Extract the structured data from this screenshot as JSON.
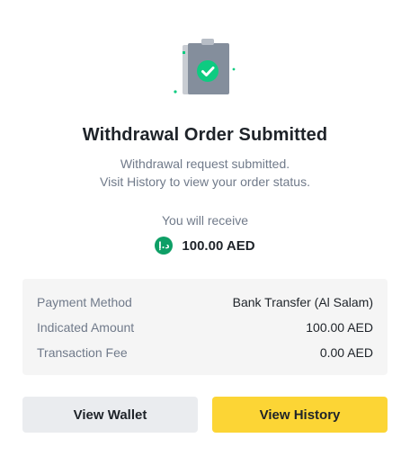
{
  "illustration": {
    "icon": "clipboard-checkmark-icon",
    "accent_color": "#0ECB81"
  },
  "header": {
    "title": "Withdrawal Order Submitted",
    "subtitle_line1": "Withdrawal request submitted.",
    "subtitle_line2": "Visit History to view your order status."
  },
  "receive": {
    "label": "You will receive",
    "currency_icon": "aed-currency-icon",
    "currency_glyph": "د.إ",
    "amount": "100.00 AED"
  },
  "details": {
    "rows": [
      {
        "label": "Payment Method",
        "value": "Bank Transfer (Al Salam)"
      },
      {
        "label": "Indicated Amount",
        "value": "100.00 AED"
      },
      {
        "label": "Transaction Fee",
        "value": "0.00 AED"
      }
    ]
  },
  "actions": {
    "wallet_label": "View Wallet",
    "history_label": "View History"
  },
  "colors": {
    "primary_button": "#FCD535",
    "secondary_button": "#EAECEF",
    "success": "#0ECB81"
  }
}
